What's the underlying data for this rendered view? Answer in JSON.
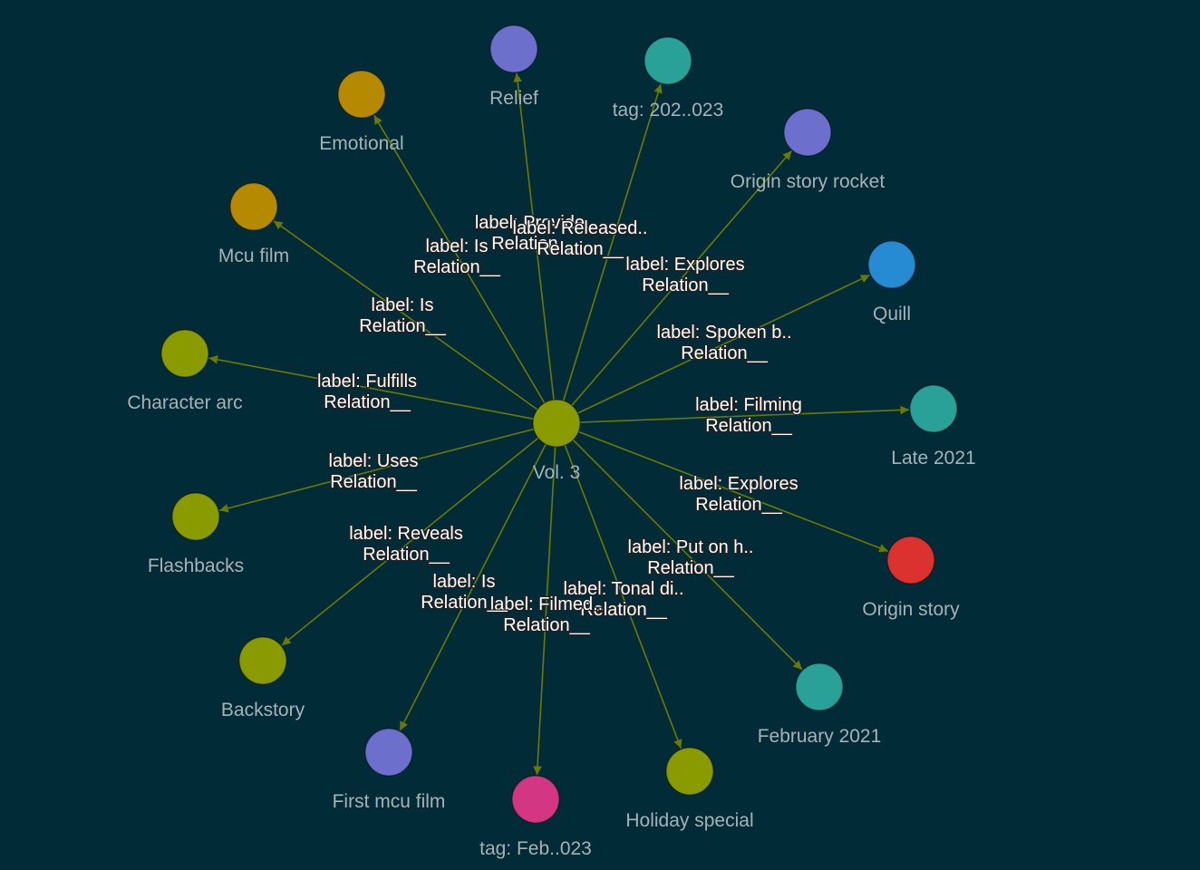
{
  "graph": {
    "center": {
      "id": "vol3",
      "label": "Vol. 3",
      "color": "#8a9b00"
    },
    "edge_color": "#6b7a00",
    "nodes": [
      {
        "id": "relief",
        "label": "Relief",
        "color": "#6c6fcc",
        "edge_label": [
          "label: Provide..",
          "Relation__"
        ]
      },
      {
        "id": "tag2023",
        "label": "tag: 202..023",
        "color": "#2aa198",
        "edge_label": [
          "label: Released..",
          "Relation__"
        ]
      },
      {
        "id": "origin-story-rocket",
        "label": "Origin story rocket",
        "color": "#6c6fcc",
        "edge_label": [
          "label: Explores",
          "Relation__"
        ]
      },
      {
        "id": "quill",
        "label": "Quill",
        "color": "#268bd2",
        "edge_label": [
          "label: Spoken b..",
          "Relation__"
        ]
      },
      {
        "id": "late-2021",
        "label": "Late 2021",
        "color": "#2aa198",
        "edge_label": [
          "label: Filming",
          "Relation__"
        ]
      },
      {
        "id": "origin-story",
        "label": "Origin story",
        "color": "#dc322f",
        "edge_label": [
          "label: Explores",
          "Relation__"
        ]
      },
      {
        "id": "february-2021",
        "label": "February 2021",
        "color": "#2aa198",
        "edge_label": [
          "label: Put on h..",
          "Relation__"
        ]
      },
      {
        "id": "holiday-special",
        "label": "Holiday special",
        "color": "#8a9b00",
        "edge_label": [
          "label: Tonal di..",
          "Relation__"
        ]
      },
      {
        "id": "tag-feb",
        "label": "tag: Feb..023",
        "color": "#d33682",
        "edge_label": [
          "label: Filmed..",
          "Relation__"
        ]
      },
      {
        "id": "first-mcu-film",
        "label": "First mcu film",
        "color": "#6c6fcc",
        "edge_label": [
          "label: Is",
          "Relation__"
        ]
      },
      {
        "id": "backstory",
        "label": "Backstory",
        "color": "#8a9b00",
        "edge_label": [
          "label: Reveals",
          "Relation__"
        ]
      },
      {
        "id": "flashbacks",
        "label": "Flashbacks",
        "color": "#8a9b00",
        "edge_label": [
          "label: Uses",
          "Relation__"
        ]
      },
      {
        "id": "character-arc",
        "label": "Character arc",
        "color": "#8a9b00",
        "edge_label": [
          "label: Fulfills",
          "Relation__"
        ]
      },
      {
        "id": "mcu-film",
        "label": "Mcu film",
        "color": "#b58900",
        "edge_label": [
          "label: Is",
          "Relation__"
        ]
      },
      {
        "id": "emotional",
        "label": "Emotional",
        "color": "#b58900",
        "edge_label": [
          "label: Is",
          "Relation__"
        ]
      }
    ]
  }
}
